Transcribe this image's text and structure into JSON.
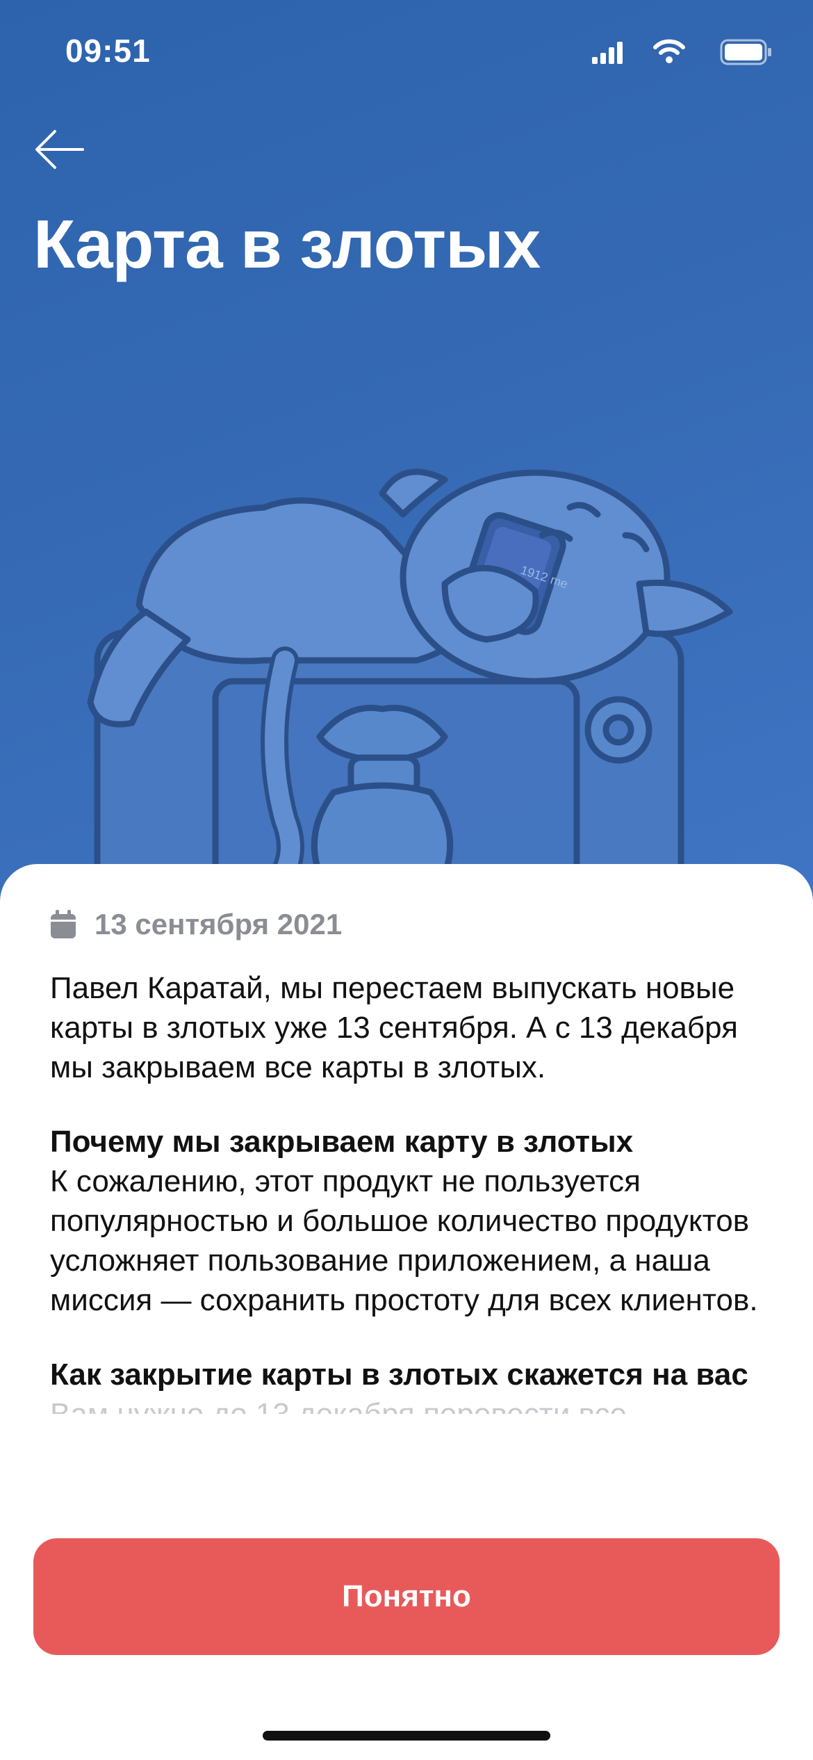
{
  "status_bar": {
    "time": "09:51"
  },
  "header": {
    "title": "Карта в злотых",
    "back_icon": "arrow-left-icon"
  },
  "illustration": {
    "card_text": "1912 me"
  },
  "notice": {
    "date": "13 сентября 2021",
    "intro": "Павел Каратай, мы перестаем выпускать новые карты в злотых уже 13 сентября. А с 13 декабря мы закрываем все карты в злотых.",
    "sections": [
      {
        "title": "Почему мы закрываем карту в злотых",
        "body": "К сожалению, этот продукт не пользуется популярностью и большое количество продуктов усложняет пользование приложением, а наша миссия — сохранить простоту для всех клиентов."
      },
      {
        "title": "Как закрытие карты в злотых скажется на вас",
        "body": "Вам нужно до 13 декабря перевести все"
      }
    ]
  },
  "actions": {
    "ok_label": "Понятно"
  },
  "colors": {
    "hero": "#3569b3",
    "button": "#e85a5a"
  }
}
